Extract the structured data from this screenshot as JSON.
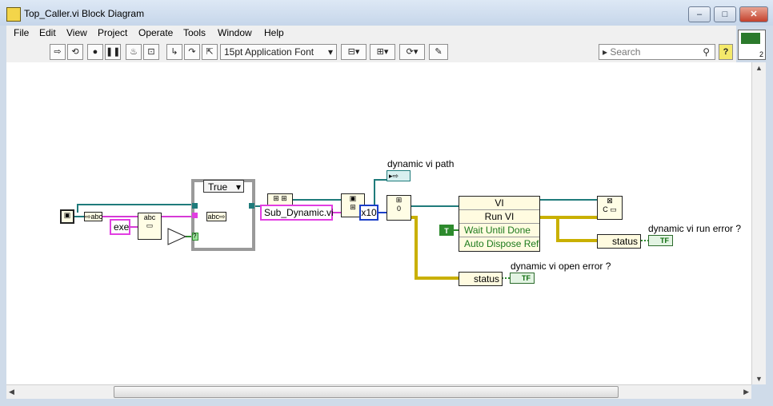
{
  "window": {
    "title": "Top_Caller.vi Block Diagram",
    "minimize": "–",
    "maximize": "□",
    "close": "✕"
  },
  "menu": [
    "File",
    "Edit",
    "View",
    "Project",
    "Operate",
    "Tools",
    "Window",
    "Help"
  ],
  "toolbar": {
    "font": "15pt Application Font",
    "search_placeholder": "Search",
    "help": "?",
    "vi_icon_number": "2"
  },
  "diagram": {
    "case_selector": "True",
    "const_exe": "exe",
    "const_vi_name": "Sub_Dynamic.vi",
    "const_option": "x10",
    "zero_const": "0",
    "bool_const": "T",
    "path_indicator_label": "dynamic vi path",
    "invoke_class": "VI",
    "invoke_method": "Run VI",
    "invoke_param1": "Wait Until Done",
    "invoke_param2": "Auto Dispose Ref",
    "status1": "status",
    "status2": "status",
    "run_error_label": "dynamic vi run error ?",
    "open_error_label": "dynamic vi open error ?",
    "tf1": "TF",
    "tf2": "TF"
  }
}
